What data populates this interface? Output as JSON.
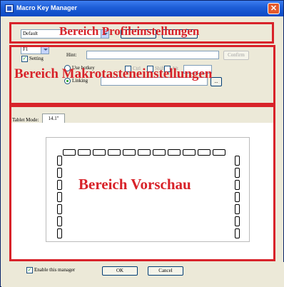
{
  "window": {
    "title": "Macro Key Manager",
    "close_glyph": "✕"
  },
  "profile_section": {
    "overlay_label": "Bereich Profileinstellungen",
    "profile_select_value": "Default",
    "buttons": [
      "",
      ""
    ]
  },
  "macro_section": {
    "overlay_label": "Bereich Makrotasteneinstellungen",
    "key_select_value": "F1",
    "setting_label": "Setting",
    "setting_checked": true,
    "hint_label": "Hint:",
    "hint_value": "",
    "confirm_label": "Confirm",
    "use_hotkey_label": "Use hotkey",
    "modifiers": [
      "Ctrl",
      "Shift",
      "Alt"
    ],
    "linking_label": "Linking",
    "linking_value": "",
    "browse_label": "..."
  },
  "tablet_mode": {
    "label": "Tablet Mode:",
    "tab_label": "14.1\""
  },
  "preview_section": {
    "overlay_label": "Bereich Vorschau",
    "top_key_count": 11,
    "left_key_count": 7,
    "right_key_count": 7
  },
  "footer": {
    "enable_label": "Enable this manager",
    "enable_checked": true,
    "ok_label": "OK",
    "cancel_label": "Cancel"
  },
  "colors": {
    "annotation_red": "#d8232a",
    "titlebar_blue": "#1f5fd8",
    "check_green": "#21a121"
  },
  "icons": {
    "app": "app-icon",
    "close": "close-icon",
    "dropdown": "chevron-down-icon",
    "check": "check-icon"
  }
}
